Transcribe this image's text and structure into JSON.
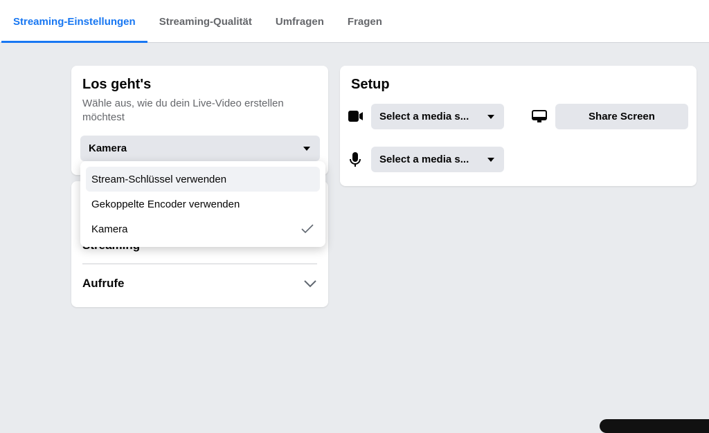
{
  "tabs": [
    {
      "label": "Streaming-Einstellungen",
      "active": true
    },
    {
      "label": "Streaming-Qualität"
    },
    {
      "label": "Umfragen"
    },
    {
      "label": "Fragen"
    }
  ],
  "start": {
    "title": "Los geht's",
    "subtitle": "Wähle aus, wie du dein Live-Video erstellen möchtest",
    "selected": "Kamera",
    "options": [
      "Stream-Schlüssel verwenden",
      "Gekoppelte Encoder verwenden",
      "Kamera"
    ]
  },
  "sections": [
    "Streaming",
    "Aufrufe"
  ],
  "setup": {
    "title": "Setup",
    "camera_select": "Select a media s...",
    "mic_select": "Select a media s...",
    "share_screen": "Share Screen"
  },
  "colors": {
    "accent": "#1877f2",
    "background": "#e9ebee"
  }
}
